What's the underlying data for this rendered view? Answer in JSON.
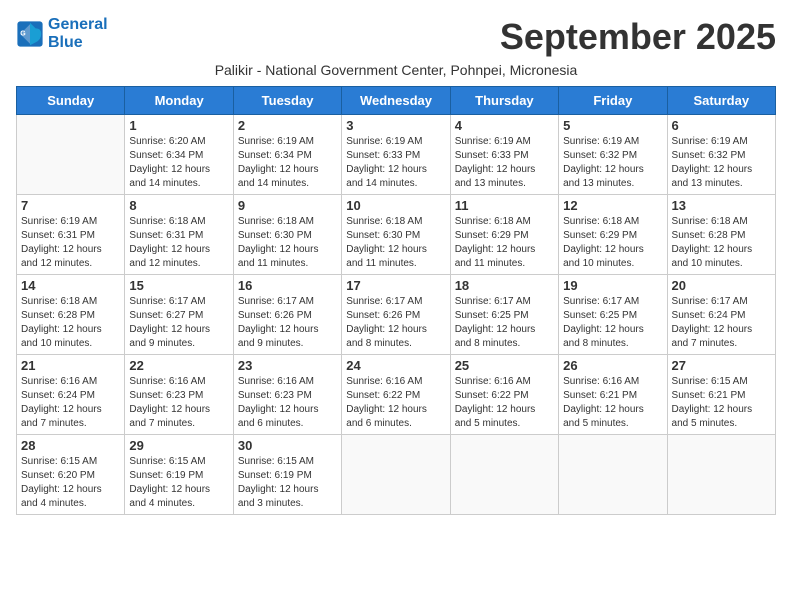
{
  "header": {
    "logo_line1": "General",
    "logo_line2": "Blue",
    "month_title": "September 2025",
    "subtitle": "Palikir - National Government Center, Pohnpei, Micronesia"
  },
  "weekdays": [
    "Sunday",
    "Monday",
    "Tuesday",
    "Wednesday",
    "Thursday",
    "Friday",
    "Saturday"
  ],
  "weeks": [
    [
      {
        "num": "",
        "empty": true
      },
      {
        "num": "1",
        "sunrise": "6:20 AM",
        "sunset": "6:34 PM",
        "daylight": "12 hours and 14 minutes."
      },
      {
        "num": "2",
        "sunrise": "6:19 AM",
        "sunset": "6:34 PM",
        "daylight": "12 hours and 14 minutes."
      },
      {
        "num": "3",
        "sunrise": "6:19 AM",
        "sunset": "6:33 PM",
        "daylight": "12 hours and 14 minutes."
      },
      {
        "num": "4",
        "sunrise": "6:19 AM",
        "sunset": "6:33 PM",
        "daylight": "12 hours and 13 minutes."
      },
      {
        "num": "5",
        "sunrise": "6:19 AM",
        "sunset": "6:32 PM",
        "daylight": "12 hours and 13 minutes."
      },
      {
        "num": "6",
        "sunrise": "6:19 AM",
        "sunset": "6:32 PM",
        "daylight": "12 hours and 13 minutes."
      }
    ],
    [
      {
        "num": "7",
        "sunrise": "6:19 AM",
        "sunset": "6:31 PM",
        "daylight": "12 hours and 12 minutes."
      },
      {
        "num": "8",
        "sunrise": "6:18 AM",
        "sunset": "6:31 PM",
        "daylight": "12 hours and 12 minutes."
      },
      {
        "num": "9",
        "sunrise": "6:18 AM",
        "sunset": "6:30 PM",
        "daylight": "12 hours and 11 minutes."
      },
      {
        "num": "10",
        "sunrise": "6:18 AM",
        "sunset": "6:30 PM",
        "daylight": "12 hours and 11 minutes."
      },
      {
        "num": "11",
        "sunrise": "6:18 AM",
        "sunset": "6:29 PM",
        "daylight": "12 hours and 11 minutes."
      },
      {
        "num": "12",
        "sunrise": "6:18 AM",
        "sunset": "6:29 PM",
        "daylight": "12 hours and 10 minutes."
      },
      {
        "num": "13",
        "sunrise": "6:18 AM",
        "sunset": "6:28 PM",
        "daylight": "12 hours and 10 minutes."
      }
    ],
    [
      {
        "num": "14",
        "sunrise": "6:18 AM",
        "sunset": "6:28 PM",
        "daylight": "12 hours and 10 minutes."
      },
      {
        "num": "15",
        "sunrise": "6:17 AM",
        "sunset": "6:27 PM",
        "daylight": "12 hours and 9 minutes."
      },
      {
        "num": "16",
        "sunrise": "6:17 AM",
        "sunset": "6:26 PM",
        "daylight": "12 hours and 9 minutes."
      },
      {
        "num": "17",
        "sunrise": "6:17 AM",
        "sunset": "6:26 PM",
        "daylight": "12 hours and 8 minutes."
      },
      {
        "num": "18",
        "sunrise": "6:17 AM",
        "sunset": "6:25 PM",
        "daylight": "12 hours and 8 minutes."
      },
      {
        "num": "19",
        "sunrise": "6:17 AM",
        "sunset": "6:25 PM",
        "daylight": "12 hours and 8 minutes."
      },
      {
        "num": "20",
        "sunrise": "6:17 AM",
        "sunset": "6:24 PM",
        "daylight": "12 hours and 7 minutes."
      }
    ],
    [
      {
        "num": "21",
        "sunrise": "6:16 AM",
        "sunset": "6:24 PM",
        "daylight": "12 hours and 7 minutes."
      },
      {
        "num": "22",
        "sunrise": "6:16 AM",
        "sunset": "6:23 PM",
        "daylight": "12 hours and 7 minutes."
      },
      {
        "num": "23",
        "sunrise": "6:16 AM",
        "sunset": "6:23 PM",
        "daylight": "12 hours and 6 minutes."
      },
      {
        "num": "24",
        "sunrise": "6:16 AM",
        "sunset": "6:22 PM",
        "daylight": "12 hours and 6 minutes."
      },
      {
        "num": "25",
        "sunrise": "6:16 AM",
        "sunset": "6:22 PM",
        "daylight": "12 hours and 5 minutes."
      },
      {
        "num": "26",
        "sunrise": "6:16 AM",
        "sunset": "6:21 PM",
        "daylight": "12 hours and 5 minutes."
      },
      {
        "num": "27",
        "sunrise": "6:15 AM",
        "sunset": "6:21 PM",
        "daylight": "12 hours and 5 minutes."
      }
    ],
    [
      {
        "num": "28",
        "sunrise": "6:15 AM",
        "sunset": "6:20 PM",
        "daylight": "12 hours and 4 minutes."
      },
      {
        "num": "29",
        "sunrise": "6:15 AM",
        "sunset": "6:19 PM",
        "daylight": "12 hours and 4 minutes."
      },
      {
        "num": "30",
        "sunrise": "6:15 AM",
        "sunset": "6:19 PM",
        "daylight": "12 hours and 3 minutes."
      },
      {
        "num": "",
        "empty": true
      },
      {
        "num": "",
        "empty": true
      },
      {
        "num": "",
        "empty": true
      },
      {
        "num": "",
        "empty": true
      }
    ]
  ]
}
